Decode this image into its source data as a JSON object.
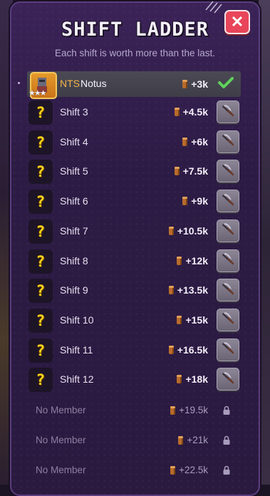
{
  "header": {
    "title": "SHIFT LADDER",
    "subtitle": "Each shift is worth more than the last.",
    "close_label": "✕"
  },
  "current": {
    "tag": "NTS",
    "name": "Notus",
    "reward": "+3k",
    "stars": "★★★"
  },
  "shifts": [
    {
      "label": "Shift 3",
      "reward": "+4.5k"
    },
    {
      "label": "Shift 4",
      "reward": "+6k"
    },
    {
      "label": "Shift 5",
      "reward": "+7.5k"
    },
    {
      "label": "Shift 6",
      "reward": "+9k"
    },
    {
      "label": "Shift 7",
      "reward": "+10.5k"
    },
    {
      "label": "Shift 8",
      "reward": "+12k"
    },
    {
      "label": "Shift 9",
      "reward": "+13.5k"
    },
    {
      "label": "Shift 10",
      "reward": "+15k"
    },
    {
      "label": "Shift 11",
      "reward": "+16.5k"
    },
    {
      "label": "Shift 12",
      "reward": "+18k"
    }
  ],
  "empty_slots": [
    {
      "label": "No Member",
      "reward": "+19.5k"
    },
    {
      "label": "No Member",
      "reward": "+21k"
    },
    {
      "label": "No Member",
      "reward": "+22.5k"
    }
  ],
  "question_mark": "?",
  "icons": {
    "close": "close-icon",
    "check": "check-icon",
    "pickaxe": "pickaxe-icon",
    "lock": "lock-icon",
    "wood": "wood-log-icon"
  },
  "colors": {
    "accent_close": "#e8455a",
    "check_green": "#5fd35a",
    "question_yellow": "#ffd21e",
    "tag_orange": "#f5b24a"
  }
}
